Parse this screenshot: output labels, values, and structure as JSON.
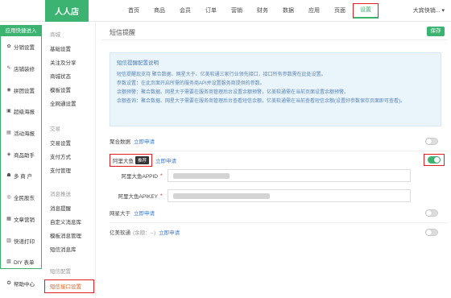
{
  "topbar": {
    "logo": "人人店",
    "nav": [
      "首页",
      "商品",
      "会员",
      "订单",
      "营销",
      "财务",
      "数据",
      "应用",
      "页面",
      "设置"
    ],
    "active_index": 9,
    "user": "大宾快销... ▾"
  },
  "quickbar": {
    "title": "应用快捷进入",
    "items": [
      {
        "label": "分销设置",
        "icon": "share-icon"
      },
      {
        "label": "店铺装修",
        "icon": "brush-icon"
      },
      {
        "label": "拼团设置",
        "icon": "group-icon"
      },
      {
        "label": "超级海报",
        "icon": "poster-icon"
      },
      {
        "label": "活动海报",
        "icon": "image-icon"
      },
      {
        "label": "商品助手",
        "icon": "goods-icon"
      },
      {
        "label": "多 商 户",
        "icon": "users-icon"
      },
      {
        "label": "全民股东",
        "icon": "shareholder-icon"
      },
      {
        "label": "文章营销",
        "icon": "article-icon"
      },
      {
        "label": "快递打印",
        "icon": "printer-icon"
      },
      {
        "label": "DIY 表单",
        "icon": "form-icon"
      },
      {
        "label": "帮助中心",
        "icon": "help-icon"
      }
    ]
  },
  "subbar": {
    "groups": [
      {
        "title": "商城",
        "items": [
          "基础设置",
          "关注及分享",
          "商城状态",
          "模板设置",
          "全网通设置"
        ]
      },
      {
        "title": "交易",
        "items": [
          "交易设置",
          "支付方式",
          "支付管理"
        ]
      },
      {
        "title": "消息推送",
        "items": [
          "消息提醒",
          "自定义消息库",
          "模板消息管理",
          "短信消息库"
        ]
      },
      {
        "title": "短信配置",
        "items": [
          "短信接口设置"
        ]
      }
    ],
    "active": "短信接口设置"
  },
  "main": {
    "title": "短信提醒",
    "save_label": "保存",
    "notice": {
      "title": "短信提醒配置说明",
      "lines": [
        "短信提醒现支持 聚合数据、网星大于、亿美软通三家行业领先接口，接口所有参数需在此处设置。",
        "参数设置：在此页面开启所需的服务商API并设置服务商提供的参数。",
        "余额预警：聚合数据、网星大于需要在服务商管理后台设置余额预警，亿美软通需在当前页面设置余额预警。",
        "余额查询：聚合数据、网星大于需要在服务商管理后台查看短信余额，亿美软通需在当前查看短信余额(设置好参数保存页面即可查看)。"
      ]
    },
    "providers": {
      "juhe": {
        "label": "聚合数据",
        "link": "立即申请",
        "enabled": false
      },
      "alidayu": {
        "label": "阿里大鱼",
        "badge": "推荐",
        "link": "立即申请",
        "enabled": true
      },
      "wangxing": {
        "label": "网星大于",
        "link": "立即申请",
        "enabled": false
      },
      "yimei": {
        "label": "亿美软通",
        "extra": "(余额：--)",
        "link": "立即申请",
        "enabled": false
      }
    },
    "fields": {
      "appid_label": "阿里大鱼APPID",
      "appkey_label": "阿里大鱼APIKEY",
      "required_mark": "*"
    }
  }
}
